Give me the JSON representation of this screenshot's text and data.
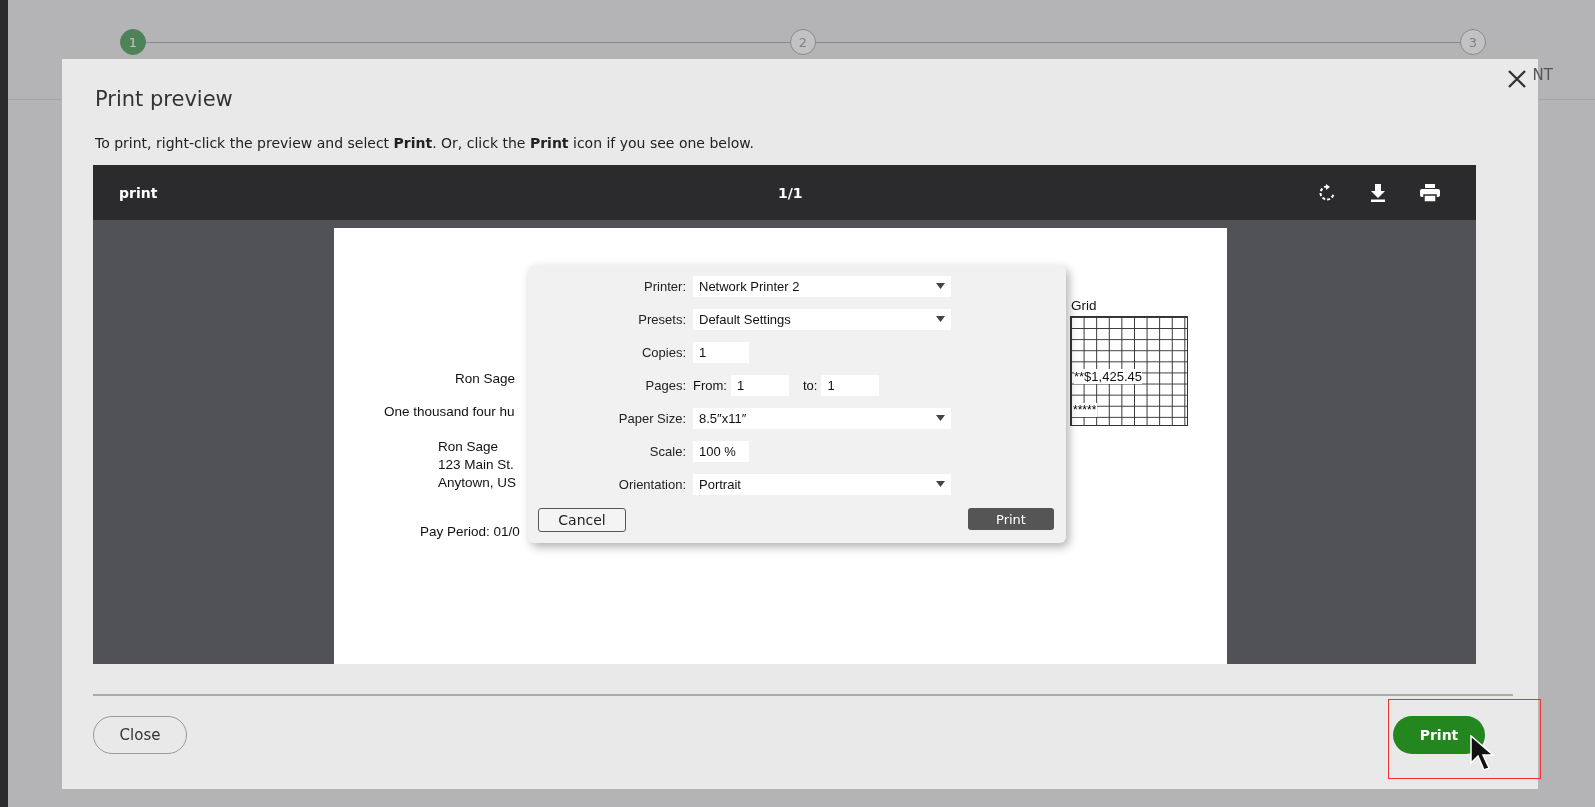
{
  "stepper": {
    "steps": [
      {
        "number": "1",
        "selected": true
      },
      {
        "number": "2",
        "selected": false
      },
      {
        "number": "3",
        "selected": false
      }
    ],
    "trailing_text": "NT"
  },
  "modal": {
    "title": "Print preview",
    "instructions": "To print, right-click the preview and select **Print**. Or, click the **Print** icon if you see one below.",
    "viewer": {
      "title": "print",
      "page_indicator": "1/1",
      "document": {
        "payee": "Ron Sage",
        "amount_words": "One thousand four hu",
        "address": [
          "Ron Sage",
          "123 Main St.",
          "Anytown, US"
        ],
        "pay_period": "Pay Period: 01/0",
        "grid": {
          "title": "Grid",
          "amount": "**$1,425.45",
          "stars": "*****"
        },
        "dialog": {
          "fields": [
            {
              "kind": "select",
              "label": "Printer:",
              "value": "Network Printer 2"
            },
            {
              "kind": "select",
              "label": "Presets:",
              "value": "Default Settings"
            },
            {
              "kind": "input",
              "label": "Copies:",
              "value": "1"
            },
            {
              "kind": "range",
              "label": "Pages:",
              "from_label": "From:",
              "from": "1",
              "to_label": "to:",
              "to": "1"
            },
            {
              "kind": "select",
              "label": "Paper Size:",
              "value": "8.5″x11″"
            },
            {
              "kind": "input",
              "label": "Scale:",
              "value": "100 %"
            },
            {
              "kind": "select",
              "label": "Orientation:",
              "value": "Portrait"
            }
          ],
          "cancel": "Cancel",
          "print": "Print"
        }
      }
    },
    "close_button": "Close",
    "print_button": "Print"
  }
}
